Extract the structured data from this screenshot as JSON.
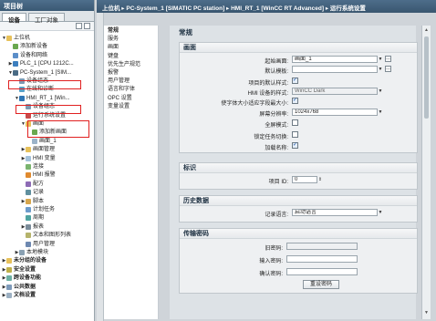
{
  "tree": {
    "header": "项目树",
    "tabs": [
      "设备",
      "工厂对象"
    ],
    "items": [
      {
        "label": "上位机",
        "indent": 0,
        "arrow": "▼",
        "icon": "folder"
      },
      {
        "label": "添加新设备",
        "indent": 1,
        "arrow": "",
        "icon": "add"
      },
      {
        "label": "设备和网络",
        "indent": 1,
        "arrow": "",
        "icon": "network"
      },
      {
        "label": "PLC_1 [CPU 1212C...",
        "indent": 1,
        "arrow": "▶",
        "icon": "plc"
      },
      {
        "label": "PC-System_1 [SIM...",
        "indent": 1,
        "arrow": "▼",
        "icon": "pc"
      },
      {
        "label": "设备组态",
        "indent": 2,
        "arrow": "",
        "icon": "config"
      },
      {
        "label": "在线和诊断",
        "indent": 2,
        "arrow": "",
        "icon": "diag"
      },
      {
        "label": "HMI_RT_1 [Win...",
        "indent": 2,
        "arrow": "▼",
        "icon": "hmi"
      },
      {
        "label": "设备组态",
        "indent": 3,
        "arrow": "",
        "icon": "config"
      },
      {
        "label": "运行系统设置",
        "indent": 3,
        "arrow": "",
        "icon": "runtime"
      },
      {
        "label": "画面",
        "indent": 3,
        "arrow": "▼",
        "icon": "folder"
      },
      {
        "label": "添加新画面",
        "indent": 4,
        "arrow": "",
        "icon": "add"
      },
      {
        "label": "画面_1",
        "indent": 4,
        "arrow": "",
        "icon": "screen"
      },
      {
        "label": "画面管理",
        "indent": 3,
        "arrow": "▶",
        "icon": "folder"
      },
      {
        "label": "HMI 变量",
        "indent": 3,
        "arrow": "▶",
        "icon": "tag"
      },
      {
        "label": "连接",
        "indent": 3,
        "arrow": "",
        "icon": "conn"
      },
      {
        "label": "HMI 报警",
        "indent": 3,
        "arrow": "",
        "icon": "alarm"
      },
      {
        "label": "配方",
        "indent": 3,
        "arrow": "",
        "icon": "recipe"
      },
      {
        "label": "记录",
        "indent": 3,
        "arrow": "",
        "icon": "log"
      },
      {
        "label": "脚本",
        "indent": 3,
        "arrow": "▶",
        "icon": "script"
      },
      {
        "label": "计划任务",
        "indent": 3,
        "arrow": "",
        "icon": "task"
      },
      {
        "label": "周期",
        "indent": 3,
        "arrow": "",
        "icon": "cycle"
      },
      {
        "label": "报表",
        "indent": 3,
        "arrow": "▶",
        "icon": "report"
      },
      {
        "label": "文本和图形列表",
        "indent": 3,
        "arrow": "",
        "icon": "list"
      },
      {
        "label": "用户管理",
        "indent": 3,
        "arrow": "",
        "icon": "user"
      },
      {
        "label": "本地模块",
        "indent": 2,
        "arrow": "▶",
        "icon": "module"
      },
      {
        "label": "未分组的设备",
        "indent": 0,
        "arrow": "▶",
        "icon": "folder"
      },
      {
        "label": "安全设置",
        "indent": 0,
        "arrow": "▶",
        "icon": "security"
      },
      {
        "label": "跨设备功能",
        "indent": 0,
        "arrow": "▶",
        "icon": "cross"
      },
      {
        "label": "公共数据",
        "indent": 0,
        "arrow": "▶",
        "icon": "data"
      },
      {
        "label": "文档设置",
        "indent": 0,
        "arrow": "▶",
        "icon": "doc"
      }
    ]
  },
  "breadcrumb": "上位机 ▸ PC-System_1 [SIMATIC PC station] ▸ HMI_RT_1 [WinCC RT Advanced] ▸ 运行系统设置",
  "nav": {
    "items": [
      "常规",
      "服务",
      "画面",
      "键盘",
      "优先生产规范",
      "报警",
      "用户管理",
      "语言和字体",
      "OPC 设置",
      "变量设置"
    ]
  },
  "general": {
    "title": "常规",
    "screen_section": {
      "title": "画面",
      "start_screen_label": "起始画面:",
      "start_screen_value": "画面_1",
      "template_label": "默认模板:",
      "template_value": "",
      "project_default_style_label": "项目的默认样式:",
      "hmi_style_label": "HMI 设备的样式:",
      "hmi_style_value": "WinCC Dark",
      "adapt_window_label": "使字体大小适应字段最大小:",
      "resolution_label": "屏幕分辨率:",
      "resolution_value": "1024x768",
      "fullscreen_label": "全屏模式:",
      "lock_switch_label": "锁定任务切换:",
      "load_names_label": "加载名称:"
    },
    "id_section": {
      "title": "标识",
      "project_id_label": "项目 ID:",
      "project_id_value": "0"
    },
    "history_section": {
      "title": "历史数据",
      "log_language_label": "记录语言:",
      "log_language_value": "启动语言"
    },
    "transfer_section": {
      "title": "传输密码",
      "old_password_label": "旧密码:",
      "new_password_label": "输入密码:",
      "confirm_password_label": "确认密码:",
      "reset_button": "重设密码"
    }
  }
}
